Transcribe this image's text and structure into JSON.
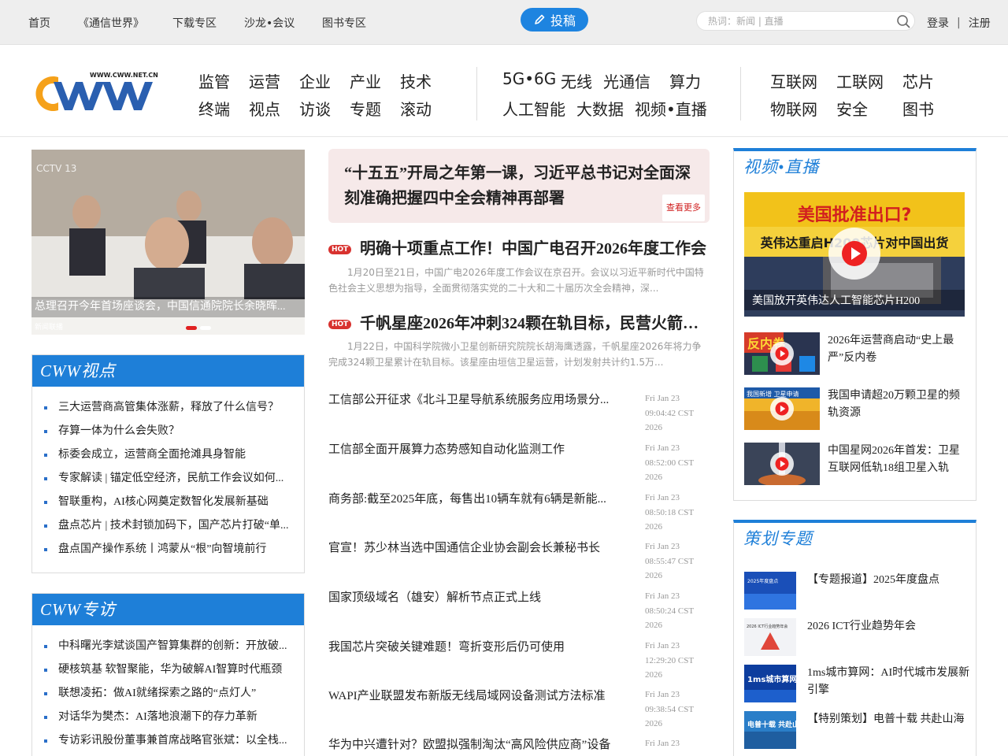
{
  "topbar": {
    "links": [
      "首页",
      "《通信世界》",
      "下载专区",
      "沙龙•会议",
      "图书专区"
    ],
    "submit_label": "投稿",
    "search_placeholder": "热词：新闻 | 直播",
    "login": "登录",
    "sep": "|",
    "register": "注册"
  },
  "logo": {
    "text": "WWW.CWW.NET.CN",
    "brand": "CWW"
  },
  "nav": {
    "group1": [
      "监管",
      "运营",
      "企业",
      "产业",
      "技术",
      "终端",
      "视点",
      "访谈",
      "专题",
      "滚动"
    ],
    "group2": [
      "5G•6G",
      "无线",
      "光通信",
      "算力",
      "人工智能",
      "大数据",
      "视频•直播"
    ],
    "group3": [
      "互联网",
      "工联网",
      "芯片",
      "物联网",
      "安全",
      "图书"
    ]
  },
  "hero": {
    "caption": "总理召开今年首场座谈会，中国信通院院长余晓晖...",
    "watermark": "CCTV 13",
    "badge": "新闻联播"
  },
  "viewpoint": {
    "title": "CWW视点",
    "items": [
      "三大运营商高管集体涨薪，释放了什么信号？",
      "存算一体为什么会失败？",
      "标委会成立，运营商全面抢滩具身智能",
      "专家解读 | 锚定低空经济，民航工作会议如何...",
      "智联重构，AI核心网奠定数智化发展新基础",
      "盘点芯片 | 技术封锁加码下，国产芯片打破“单...",
      "盘点国产操作系统丨鸿蒙从“根”向智境前行"
    ]
  },
  "interview": {
    "title": "CWW专访",
    "items": [
      "中科曙光李斌谈国产智算集群的创新：开放破...",
      "硬核筑基 软智聚能，华为破解AI智算时代瓶颈",
      "联想凌拓：做AI就绪探索之路的“点灯人”",
      "对话华为樊杰：AI落地浪潮下的存力革新",
      "专访彩讯股份董事兼首席战略官张斌：以全栈..."
    ]
  },
  "headline": {
    "text": "“十五五”开局之年第一课，习近平总书记对全面深刻准确把握四中全会精神再部署",
    "more": "查看更多"
  },
  "hot": [
    {
      "badge": "HOT",
      "title": "明确十项重点工作！中国广电召开2026年度工作会",
      "desc": "1月20日至21日，中国广电2026年度工作会议在京召开。会议以习近平新时代中国特色社会主义思想为指导，全面贯彻落实党的二十大和二十届历次全会精神，深..."
    },
    {
      "badge": "HOT",
      "title": "千帆星座2026年冲刺324颗在轨目标，民营火箭破...",
      "desc": "1月22日，中国科学院微小卫星创新研究院院长胡海鹰透露，千帆星座2026年将力争完成324颗卫星累计在轨目标。该星座由垣信卫星运营，计划发射共计约1.5万..."
    }
  ],
  "news": [
    {
      "title": "工信部公开征求《北斗卫星导航系统服务应用场景分...",
      "d1": "Fri Jan 23",
      "d2": "09:04:42 CST",
      "d3": "2026"
    },
    {
      "title": "工信部全面开展算力态势感知自动化监测工作",
      "d1": "Fri Jan 23",
      "d2": "08:52:00 CST",
      "d3": "2026"
    },
    {
      "title": "商务部:截至2025年底，每售出10辆车就有6辆是新能...",
      "d1": "Fri Jan 23",
      "d2": "08:50:18 CST",
      "d3": "2026"
    },
    {
      "title": "官宣！苏少林当选中国通信企业协会副会长兼秘书长",
      "d1": "Fri Jan 23",
      "d2": "08:55:47 CST",
      "d3": "2026"
    },
    {
      "title": "国家顶级域名（雄安）解析节点正式上线",
      "d1": "Fri Jan 23",
      "d2": "08:50:24 CST",
      "d3": "2026"
    },
    {
      "title": "我国芯片突破关键难题！弯折变形后仍可使用",
      "d1": "Fri Jan 23",
      "d2": "12:29:20 CST",
      "d3": "2026"
    },
    {
      "title": "WAPI产业联盟发布新版无线局域网设备测试方法标准",
      "d1": "Fri Jan 23",
      "d2": "09:38:54 CST",
      "d3": "2026"
    },
    {
      "title": "华为中兴遭针对？欧盟拟强制淘汰“高风险供应商”设备",
      "d1": "Fri Jan 23",
      "d2": "",
      "d3": ""
    }
  ],
  "video": {
    "title": "视频•直播",
    "main_top": "美国批准出口?",
    "main_mid": "英伟达重启H200芯片对中国出货",
    "main_caption": "美国放开英伟达人工智能芯片H200",
    "items": [
      {
        "title": "2026年运营商启动“史上最严”反内卷",
        "thumb": "反内卷"
      },
      {
        "title": "我国申请超20万颗卫星的频轨资源",
        "thumb": "我国新增 卫星申请"
      },
      {
        "title": "中国星网2026年首发：卫星互联网低轨18组卫星入轨",
        "thumb": ""
      }
    ]
  },
  "topics": {
    "title": "策划专题",
    "items": [
      {
        "title": "【专题报道】2025年度盘点",
        "thumb": "2025年度盘点"
      },
      {
        "title": "2026 ICT行业趋势年会",
        "thumb": "2026 ICT行业趋势年会"
      },
      {
        "title": "1ms城市算网：AI时代城市发展新引擎",
        "thumb": "1ms城市算网"
      },
      {
        "title": "【特别策划】电普十载 共赴山海",
        "thumb": "电普十载 共赴山海"
      }
    ]
  },
  "colors": {
    "accent": "#1e7fd8",
    "hot": "#d8322f",
    "headline_bg": "#f6e9e9",
    "topbar_bg": "#eeeeee"
  }
}
